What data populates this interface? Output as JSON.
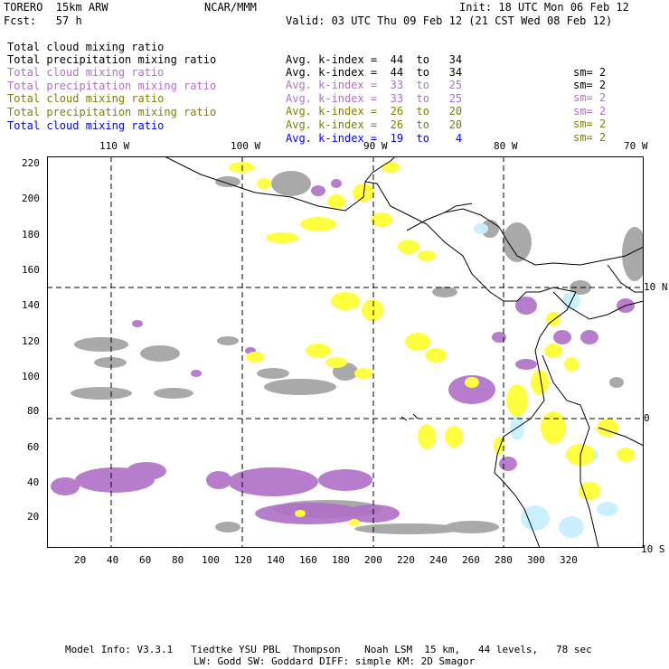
{
  "header": {
    "model": "TORERO  15km ARW",
    "org": "NCAR/MMM",
    "init": "Init: 18 UTC Mon 06 Feb 12",
    "fcst": "Fcst:   57 h",
    "valid": "Valid: 03 UTC Thu 09 Feb 12 (21 CST Wed 08 Feb 12)"
  },
  "legend": [
    {
      "field": "Total cloud mixing ratio",
      "range": "Avg. k-index =  44  to   34",
      "sm": "sm= 2",
      "color": "#000000"
    },
    {
      "field": "Total precipitation mixing ratio",
      "range": "Avg. k-index =  44  to   34",
      "sm": "sm= 2",
      "color": "#000000"
    },
    {
      "field": "Total cloud mixing ratio",
      "range": "Avg. k-index =  33  to   25",
      "sm": "sm= 2",
      "color": "#b070c8"
    },
    {
      "field": "Total precipitation mixing ratio",
      "range": "Avg. k-index =  33  to   25",
      "sm": "sm= 2",
      "color": "#b070c8"
    },
    {
      "field": "Total cloud mixing ratio",
      "range": "Avg. k-index =  26  to   20",
      "sm": "sm= 2",
      "color": "#808000"
    },
    {
      "field": "Total precipitation mixing ratio",
      "range": "Avg. k-index =  26  to   20",
      "sm": "sm= 2",
      "color": "#808000"
    },
    {
      "field": "Total cloud mixing ratio",
      "range": "Avg. k-index =  19  to    4",
      "sm": "",
      "color": "#0000ff"
    }
  ],
  "map": {
    "lon_labels": [
      "110 W",
      "100 W",
      "90 W",
      "80 W",
      "70 W"
    ],
    "lat_labels": [
      "10 N",
      "0",
      "10 S"
    ],
    "x_ticks": [
      "20",
      "40",
      "60",
      "80",
      "100",
      "120",
      "140",
      "160",
      "180",
      "200",
      "220",
      "240",
      "260",
      "280",
      "300",
      "320"
    ],
    "y_ticks": [
      "220",
      "200",
      "180",
      "160",
      "140",
      "120",
      "100",
      "80",
      "60",
      "40",
      "20"
    ],
    "colors": {
      "gray": "#a0a0a0",
      "purple": "#b070c8",
      "yellow": "#ffff40",
      "cyan": "#c8f0ff"
    }
  },
  "footer": {
    "line1": "Model Info: V3.3.1   Tiedtke YSU PBL  Thompson    Noah LSM  15 km,   44 levels,   78 sec",
    "line2": "LW: Godd SW: Goddard DIFF: simple KM: 2D Smagor"
  }
}
